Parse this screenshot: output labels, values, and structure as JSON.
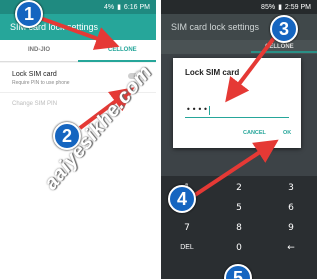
{
  "left": {
    "status_time": "6:16 PM",
    "status_battery": "4%",
    "title": "SIM card lock settings",
    "tabs": [
      "IND-JIO",
      "CELLONE"
    ],
    "lock_sim": {
      "title": "Lock SIM card",
      "subtitle": "Require PIN to use phone",
      "checked": false
    },
    "change_pin": "Change SIM PIN"
  },
  "right": {
    "status_time": "2:59 PM",
    "status_battery": "85%",
    "title": "SIM card lock settings",
    "tab_visible": "CELLONE",
    "dialog": {
      "title": "Lock SIM card",
      "pin_value": "••••",
      "cancel_label": "CANCEL",
      "ok_label": "OK"
    },
    "keypad": [
      [
        "1",
        "2",
        "3"
      ],
      [
        "4",
        "5",
        "6"
      ],
      [
        "7",
        "8",
        "9"
      ],
      [
        "DEL",
        "0",
        "←"
      ]
    ]
  },
  "annotations": {
    "steps": [
      "1",
      "2",
      "3",
      "4",
      "5"
    ],
    "watermark": "aaiyesikhe.com",
    "arrow_color": "#e53935",
    "badge_color": "#1565c0"
  },
  "colors": {
    "accent": "#26a69a",
    "dark_bg": "#3d4347"
  }
}
